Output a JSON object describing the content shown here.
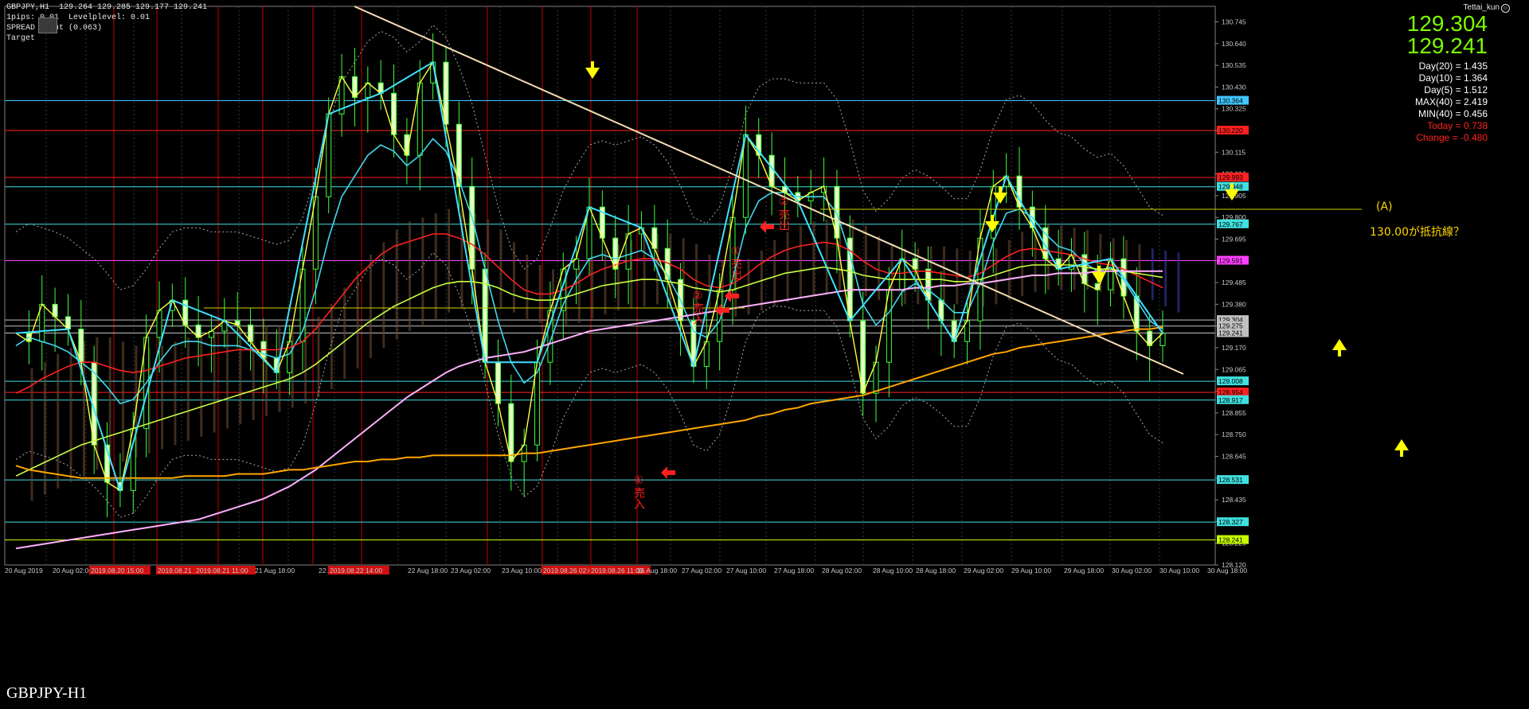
{
  "header": {
    "symbol_line": "GBPJPY,H1  129.264 129.285 129.177 129.241",
    "line2": "1pips: 0.01  Levelplevel: 0.01",
    "line3": "SPREAD Point (0.063)",
    "line4": "Target"
  },
  "timeframe_label": "GBPJPY-H1",
  "user_label": "Tettai_kun",
  "quotes": {
    "ask": "129.304",
    "bid": "129.241"
  },
  "stats": [
    {
      "text": "Day(20) = 1.435",
      "color": "#ffffff"
    },
    {
      "text": "Day(10) = 1.364",
      "color": "#ffffff"
    },
    {
      "text": "Day(5) = 1.512",
      "color": "#ffffff"
    },
    {
      "text": "MAX(40) = 2.419",
      "color": "#ffffff"
    },
    {
      "text": "MIN(40) = 0.456",
      "color": "#ffffff"
    },
    {
      "text": "Today = 0.738",
      "color": "#ff2020"
    },
    {
      "text": "Change = -0.480",
      "color": "#ff2020"
    }
  ],
  "annotations": {
    "label_a": "(A)",
    "resistance_note": "130.00が抵抗線？",
    "sig1": "①売入",
    "sig2": "②売入",
    "sig3": "①売出",
    "sig4": "②売出"
  },
  "chart_data": {
    "type": "line",
    "title": "GBPJPY,H1",
    "ylim": [
      128.12,
      130.82
    ],
    "y_ticks": [
      "130.745",
      "130.640",
      "130.535",
      "130.430",
      "130.325",
      "130.220",
      "130.115",
      "130.010",
      "129.905",
      "129.800",
      "129.695",
      "129.590",
      "129.485",
      "129.380",
      "129.275",
      "129.170",
      "129.065",
      "128.960",
      "128.855",
      "128.750",
      "128.645",
      "128.540",
      "128.435",
      "128.330",
      "128.225",
      "128.120"
    ],
    "x_ticks": [
      "20 Aug 2019",
      "20 Aug 02:00",
      "2019.08.20 15:00",
      "2019.08.21 16:00",
      "2019.08.21 11:00",
      "21 Aug 18:00",
      "22 Aug 10:00",
      "2019.08.22 14:00",
      "22 Aug 18:00",
      "23 Aug 02:00",
      "23 Aug 10:00",
      "23 Aug",
      "2019.08.26 02:00",
      "2019.08.26 11:00",
      "26 Aug 18:00",
      "27 Aug 02:00",
      "27 Aug 10:00",
      "27 Aug 18:00",
      "28 Aug 02:00",
      "28 Aug 10:00",
      "28 Aug 18:00",
      "29 Aug 02:00",
      "29 Aug 10:00",
      "29 Aug 18:00",
      "30 Aug 02:00",
      "30 Aug 10:00",
      "30 Aug 18:00"
    ],
    "price_levels": [
      {
        "value": "130.364",
        "color": "#40c8ff"
      },
      {
        "value": "130.220",
        "color": "#ff2020"
      },
      {
        "value": "129.993",
        "color": "#ff2020"
      },
      {
        "value": "129.948",
        "color": "#40e0e0"
      },
      {
        "value": "129.767",
        "color": "#40e0e0"
      },
      {
        "value": "129.591",
        "color": "#ff40ff"
      },
      {
        "value": "129.304",
        "color": "#c0c0c0"
      },
      {
        "value": "129.275",
        "color": "#c0c0c0"
      },
      {
        "value": "129.241",
        "color": "#c0c0c0"
      },
      {
        "value": "129.008",
        "color": "#40e0e0"
      },
      {
        "value": "128.954",
        "color": "#ff2020"
      },
      {
        "value": "128.917",
        "color": "#40e0e0"
      },
      {
        "value": "128.531",
        "color": "#40e0e0"
      },
      {
        "value": "128.327",
        "color": "#40e0e0"
      },
      {
        "value": "128.241",
        "color": "#c8ff00"
      }
    ],
    "series": [
      {
        "values": [
          129.24,
          129.2,
          129.38,
          129.32,
          129.26,
          129.1,
          128.7,
          128.52,
          128.48,
          128.78,
          129.22,
          129.35,
          129.4,
          129.28,
          129.22,
          129.25,
          129.3,
          129.28,
          129.2,
          129.12,
          129.05,
          129.2,
          129.55,
          129.9,
          130.3,
          130.48,
          130.38,
          130.45,
          130.4,
          130.2,
          130.1,
          130.45,
          130.55,
          130.25,
          129.95,
          129.55,
          129.1,
          128.9,
          128.62,
          128.7,
          129.1,
          129.35,
          129.55,
          129.6,
          129.85,
          129.7,
          129.55,
          129.72,
          129.75,
          129.65,
          129.5,
          129.3,
          129.08,
          129.2,
          129.45,
          129.8,
          130.2,
          130.1,
          129.95,
          129.92,
          129.88,
          129.92,
          129.95,
          129.7,
          129.3,
          128.95,
          129.1,
          129.45,
          129.6,
          129.55,
          129.4,
          129.3,
          129.2,
          129.3,
          129.7,
          129.95,
          130.0,
          129.85,
          129.75,
          129.6,
          129.55,
          129.62,
          129.48,
          129.45,
          129.6,
          129.42,
          129.25,
          129.18,
          129.24
        ]
      },
      {
        "values": [
          129.18,
          129.22,
          129.2,
          129.18,
          129.15,
          129.1,
          129.05,
          128.98,
          128.9,
          128.92,
          129.0,
          129.1,
          129.18,
          129.2,
          129.2,
          129.18,
          129.18,
          129.18,
          129.16,
          129.14,
          129.12,
          129.14,
          129.25,
          129.45,
          129.7,
          129.9,
          130.0,
          130.1,
          130.15,
          130.12,
          130.05,
          130.1,
          130.18,
          130.12,
          129.98,
          129.8,
          129.55,
          129.3,
          129.1,
          129.0,
          129.05,
          129.2,
          129.38,
          129.5,
          129.6,
          129.62,
          129.6,
          129.62,
          129.64,
          129.6,
          129.52,
          129.4,
          129.25,
          129.22,
          129.3,
          129.5,
          129.75,
          129.88,
          129.92,
          129.92,
          129.9,
          129.9,
          129.9,
          129.82,
          129.62,
          129.38,
          129.28,
          129.34,
          129.44,
          129.48,
          129.45,
          129.4,
          129.34,
          129.34,
          129.48,
          129.68,
          129.82,
          129.84,
          129.8,
          129.72,
          129.66,
          129.64,
          129.58,
          129.54,
          129.56,
          129.5,
          129.4,
          129.3,
          129.26
        ]
      },
      {
        "values": [
          128.95,
          128.98,
          129.02,
          129.05,
          129.08,
          129.1,
          129.1,
          129.08,
          129.06,
          129.05,
          129.06,
          129.08,
          129.1,
          129.12,
          129.13,
          129.14,
          129.15,
          129.16,
          129.16,
          129.16,
          129.16,
          129.17,
          129.2,
          129.26,
          129.34,
          129.42,
          129.5,
          129.56,
          129.62,
          129.66,
          129.68,
          129.7,
          129.72,
          129.72,
          129.7,
          129.67,
          129.62,
          129.56,
          129.5,
          129.45,
          129.43,
          129.43,
          129.45,
          129.48,
          129.52,
          129.55,
          129.57,
          129.59,
          129.6,
          129.6,
          129.58,
          129.55,
          129.5,
          129.47,
          129.46,
          129.48,
          129.52,
          129.57,
          129.61,
          129.64,
          129.66,
          129.67,
          129.68,
          129.67,
          129.64,
          129.59,
          129.55,
          129.53,
          129.53,
          129.54,
          129.54,
          129.53,
          129.52,
          129.51,
          129.53,
          129.57,
          129.61,
          129.64,
          129.65,
          129.64,
          129.63,
          129.62,
          129.6,
          129.58,
          129.57,
          129.55,
          129.52,
          129.49,
          129.46
        ]
      },
      {
        "values": [
          128.55,
          128.58,
          128.61,
          128.64,
          128.67,
          128.7,
          128.72,
          128.74,
          128.76,
          128.78,
          128.8,
          128.82,
          128.84,
          128.86,
          128.88,
          128.9,
          128.92,
          128.94,
          128.96,
          128.98,
          129.0,
          129.02,
          129.05,
          129.09,
          129.14,
          129.19,
          129.24,
          129.29,
          129.33,
          129.37,
          129.4,
          129.43,
          129.46,
          129.48,
          129.49,
          129.49,
          129.48,
          129.46,
          129.43,
          129.41,
          129.4,
          129.4,
          129.41,
          129.43,
          129.45,
          129.47,
          129.48,
          129.49,
          129.5,
          129.5,
          129.49,
          129.48,
          129.46,
          129.45,
          129.44,
          129.45,
          129.47,
          129.49,
          129.51,
          129.53,
          129.54,
          129.55,
          129.56,
          129.55,
          129.54,
          129.52,
          129.51,
          129.5,
          129.5,
          129.5,
          129.5,
          129.5,
          129.49,
          129.49,
          129.5,
          129.52,
          129.54,
          129.56,
          129.57,
          129.57,
          129.57,
          129.57,
          129.56,
          129.55,
          129.55,
          129.54,
          129.53,
          129.52,
          129.51
        ]
      },
      {
        "values": [
          128.2,
          128.21,
          128.22,
          128.23,
          128.24,
          128.25,
          128.26,
          128.27,
          128.28,
          128.29,
          128.3,
          128.31,
          128.32,
          128.33,
          128.34,
          128.36,
          128.38,
          128.4,
          128.42,
          128.44,
          128.47,
          128.5,
          128.54,
          128.58,
          128.63,
          128.68,
          128.73,
          128.78,
          128.83,
          128.88,
          128.93,
          128.97,
          129.01,
          129.05,
          129.08,
          129.1,
          129.12,
          129.13,
          129.14,
          129.15,
          129.17,
          129.19,
          129.21,
          129.23,
          129.25,
          129.26,
          129.27,
          129.28,
          129.29,
          129.3,
          129.31,
          129.32,
          129.33,
          129.34,
          129.35,
          129.36,
          129.37,
          129.38,
          129.39,
          129.4,
          129.41,
          129.42,
          129.43,
          129.44,
          129.45,
          129.45,
          129.45,
          129.45,
          129.45,
          129.46,
          129.46,
          129.47,
          129.47,
          129.48,
          129.48,
          129.49,
          129.5,
          129.51,
          129.52,
          129.52,
          129.53,
          129.53,
          129.53,
          129.54,
          129.54,
          129.54,
          129.54,
          129.54,
          129.54
        ]
      },
      {
        "values": [
          128.6,
          128.58,
          128.57,
          128.56,
          128.55,
          128.54,
          128.54,
          128.54,
          128.54,
          128.54,
          128.54,
          128.54,
          128.54,
          128.55,
          128.55,
          128.55,
          128.55,
          128.56,
          128.56,
          128.56,
          128.57,
          128.58,
          128.58,
          128.59,
          128.6,
          128.61,
          128.62,
          128.62,
          128.63,
          128.63,
          128.64,
          128.64,
          128.65,
          128.65,
          128.65,
          128.65,
          128.65,
          128.65,
          128.65,
          128.66,
          128.66,
          128.67,
          128.68,
          128.69,
          128.7,
          128.71,
          128.72,
          128.73,
          128.74,
          128.75,
          128.76,
          128.77,
          128.78,
          128.79,
          128.8,
          128.81,
          128.82,
          128.84,
          128.85,
          128.87,
          128.88,
          128.9,
          128.91,
          128.92,
          128.93,
          128.94,
          128.96,
          128.98,
          129.0,
          129.02,
          129.04,
          129.06,
          129.08,
          129.1,
          129.12,
          129.14,
          129.15,
          129.17,
          129.18,
          129.19,
          129.2,
          129.21,
          129.22,
          129.23,
          129.24,
          129.25,
          129.26,
          129.26,
          129.27
        ]
      }
    ]
  }
}
